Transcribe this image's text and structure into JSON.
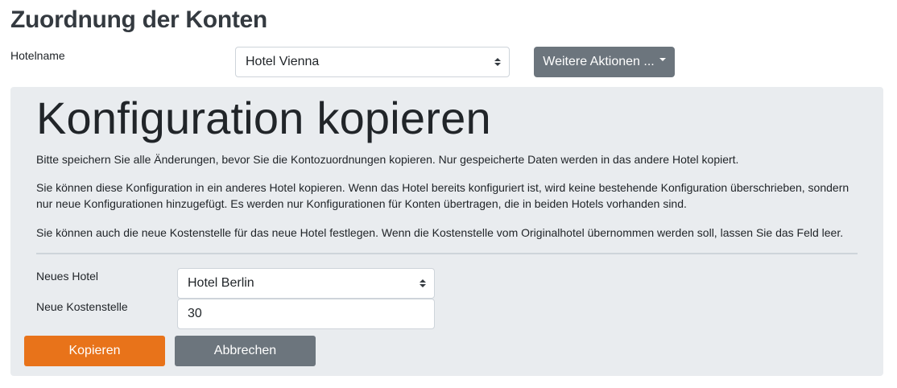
{
  "header": {
    "title": "Zuordnung der Konten",
    "hotel_label": "Hotelname",
    "hotel_selected": "Hotel Vienna",
    "actions_label": "Weitere Aktionen ..."
  },
  "panel": {
    "title": "Konfiguration kopieren",
    "paragraphs": [
      "Bitte speichern Sie alle Änderungen, bevor Sie die Kontozuordnungen kopieren. Nur gespeicherte Daten werden in das andere Hotel kopiert.",
      "Sie können diese Konfiguration in ein anderes Hotel kopieren. Wenn das Hotel bereits konfiguriert ist, wird keine bestehende Konfiguration überschrieben, sondern nur neue Konfigurationen hinzugefügt. Es werden nur Konfigurationen für Konten übertragen, die in beiden Hotels vorhanden sind.",
      "Sie können auch die neue Kostenstelle für das neue Hotel festlegen. Wenn die Kostenstelle vom Originalhotel übernommen werden soll, lassen Sie das Feld leer."
    ],
    "new_hotel_label": "Neues Hotel",
    "new_hotel_selected": "Hotel Berlin",
    "cost_center_label": "Neue Kostenstelle",
    "cost_center_value": "30",
    "copy_button": "Kopieren",
    "cancel_button": "Abbrechen"
  },
  "colors": {
    "primary_accent": "#e8731a",
    "secondary": "#6c757d",
    "panel_background": "#e9ecef"
  },
  "icons": {
    "select_caret": "sort-icon",
    "dropdown_caret": "caret-down-icon"
  }
}
